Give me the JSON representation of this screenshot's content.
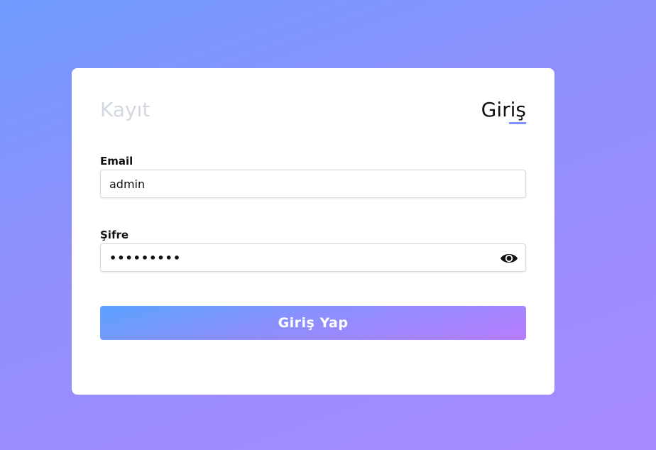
{
  "tabs": {
    "register_label": "Kayıt",
    "login_label": "Giriş"
  },
  "form": {
    "email_label": "Email",
    "email_value": "admin",
    "password_label": "Şifre",
    "password_value": "•••••••••",
    "password_toggle_icon": "eye-icon",
    "submit_label": "Giriş Yap"
  },
  "colors": {
    "accent": "#7f90ff",
    "inactive_tab": "#d3d8e0",
    "button_gradient_start": "#5aa3ff",
    "button_gradient_end": "#b77dff"
  }
}
